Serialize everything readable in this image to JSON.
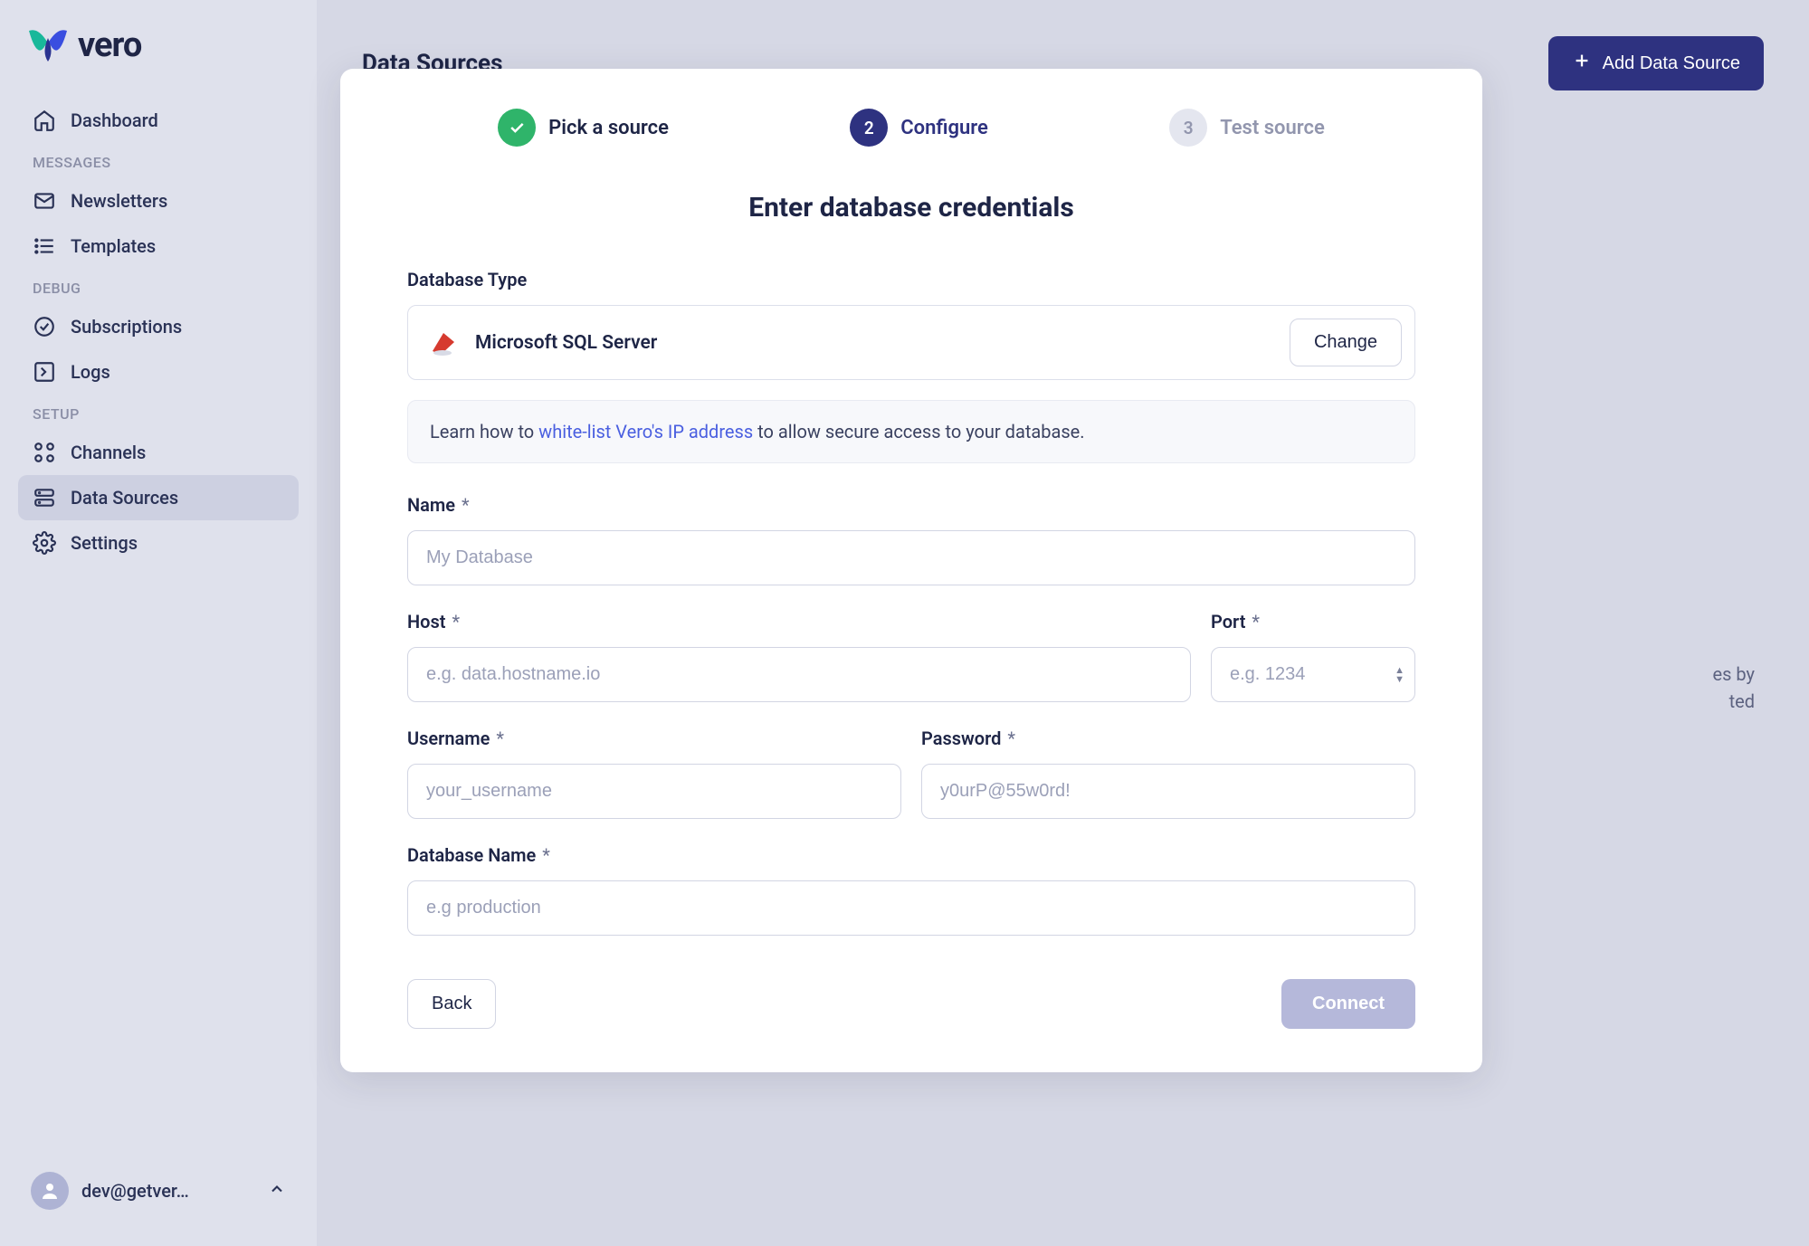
{
  "brand": {
    "name": "vero"
  },
  "sidebar": {
    "items": [
      {
        "label": "Dashboard"
      },
      {
        "label": "Newsletters"
      },
      {
        "label": "Templates"
      },
      {
        "label": "Subscriptions"
      },
      {
        "label": "Logs"
      },
      {
        "label": "Channels"
      },
      {
        "label": "Data Sources"
      },
      {
        "label": "Settings"
      }
    ],
    "groups": {
      "messages": "MESSAGES",
      "debug": "DEBUG",
      "setup": "SETUP"
    }
  },
  "user": {
    "email": "dev@getver…"
  },
  "page": {
    "title": "Data Sources",
    "add_button": "Add Data Source",
    "bg_hint_line1": "es by",
    "bg_hint_line2": "ted"
  },
  "modal": {
    "steps": {
      "pick": "Pick a source",
      "configure_num": "2",
      "configure": "Configure",
      "test_num": "3",
      "test": "Test source"
    },
    "title": "Enter database credentials",
    "db_type_label": "Database Type",
    "db_type_value": "Microsoft SQL Server",
    "change": "Change",
    "info_prefix": "Learn how to ",
    "info_link": "white-list Vero's IP address",
    "info_suffix": " to allow secure access to your database.",
    "fields": {
      "name": {
        "label": "Name",
        "placeholder": "My Database"
      },
      "host": {
        "label": "Host",
        "placeholder": "e.g. data.hostname.io"
      },
      "port": {
        "label": "Port",
        "placeholder": "e.g. 1234"
      },
      "username": {
        "label": "Username",
        "placeholder": "your_username"
      },
      "password": {
        "label": "Password",
        "placeholder": "y0urP@55w0rd!"
      },
      "dbname": {
        "label": "Database Name",
        "placeholder": "e.g production"
      }
    },
    "back": "Back",
    "connect": "Connect"
  }
}
